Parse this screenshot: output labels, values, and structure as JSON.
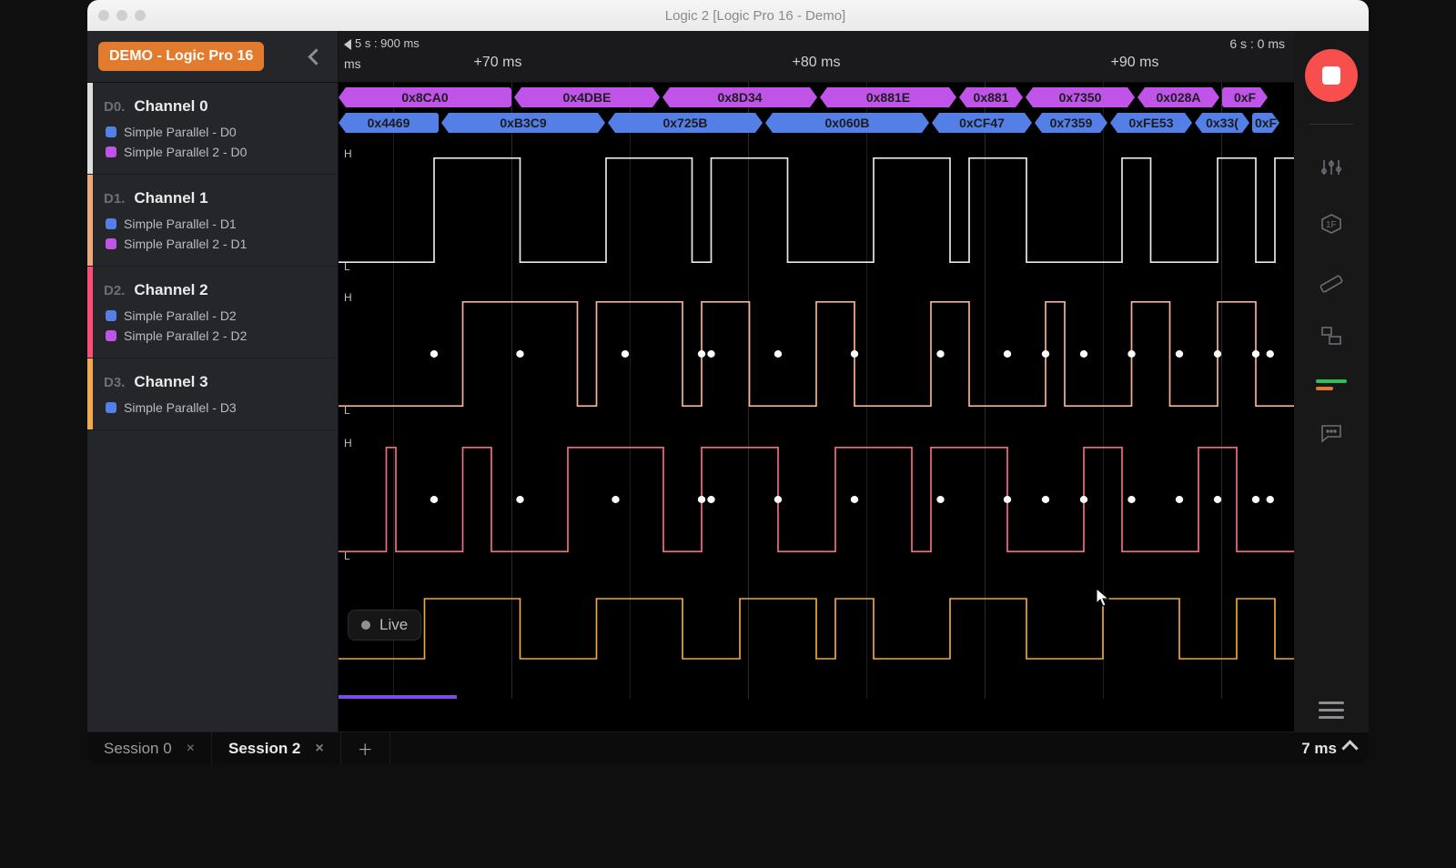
{
  "title": "Logic 2 [Logic Pro 16 - Demo]",
  "demoBadge": "DEMO - Logic Pro 16",
  "timeline": {
    "leftMark": "5 s : 900 ms",
    "rightMark": "6 s : 0 ms",
    "msLabel": "ms",
    "ticks": [
      "+70 ms",
      "+80 ms",
      "+90 ms"
    ]
  },
  "decoder": {
    "row1": [
      "0x8CA0",
      "0x4DBE",
      "0x8D34",
      "0x881E",
      "0x881",
      "0x7350",
      "0x028A",
      "0xF"
    ],
    "row1w": [
      190,
      160,
      170,
      150,
      70,
      120,
      90,
      50
    ],
    "row2": [
      "0x4469",
      "0xB3C9",
      "0x725B",
      "0x060B",
      "0xCF47",
      "0x7359",
      "0xFE53",
      "0x33(",
      "0xF"
    ],
    "row2w": [
      110,
      180,
      170,
      180,
      110,
      80,
      90,
      60,
      30
    ]
  },
  "channels": [
    {
      "idx": "D0.",
      "name": "Channel 0",
      "stripe": "c0",
      "wave": "white",
      "subs": [
        {
          "c": "blue",
          "t": "Simple Parallel - D0"
        },
        {
          "c": "purple",
          "t": "Simple Parallel 2 - D0"
        }
      ]
    },
    {
      "idx": "D1.",
      "name": "Channel 1",
      "stripe": "c1",
      "wave": "peach",
      "subs": [
        {
          "c": "blue",
          "t": "Simple Parallel - D1"
        },
        {
          "c": "purple",
          "t": "Simple Parallel 2 - D1"
        }
      ]
    },
    {
      "idx": "D2.",
      "name": "Channel 2",
      "stripe": "c2",
      "wave": "pink",
      "subs": [
        {
          "c": "blue",
          "t": "Simple Parallel - D2"
        },
        {
          "c": "purple",
          "t": "Simple Parallel 2 - D2"
        }
      ]
    },
    {
      "idx": "D3.",
      "name": "Channel 3",
      "stripe": "c3",
      "wave": "amber",
      "subs": [
        {
          "c": "blue",
          "t": "Simple Parallel - D3"
        }
      ]
    }
  ],
  "live": "Live",
  "tabs": [
    {
      "label": "Session 0",
      "active": false
    },
    {
      "label": "Session 2",
      "active": true
    }
  ],
  "timeFooter": "7 ms"
}
